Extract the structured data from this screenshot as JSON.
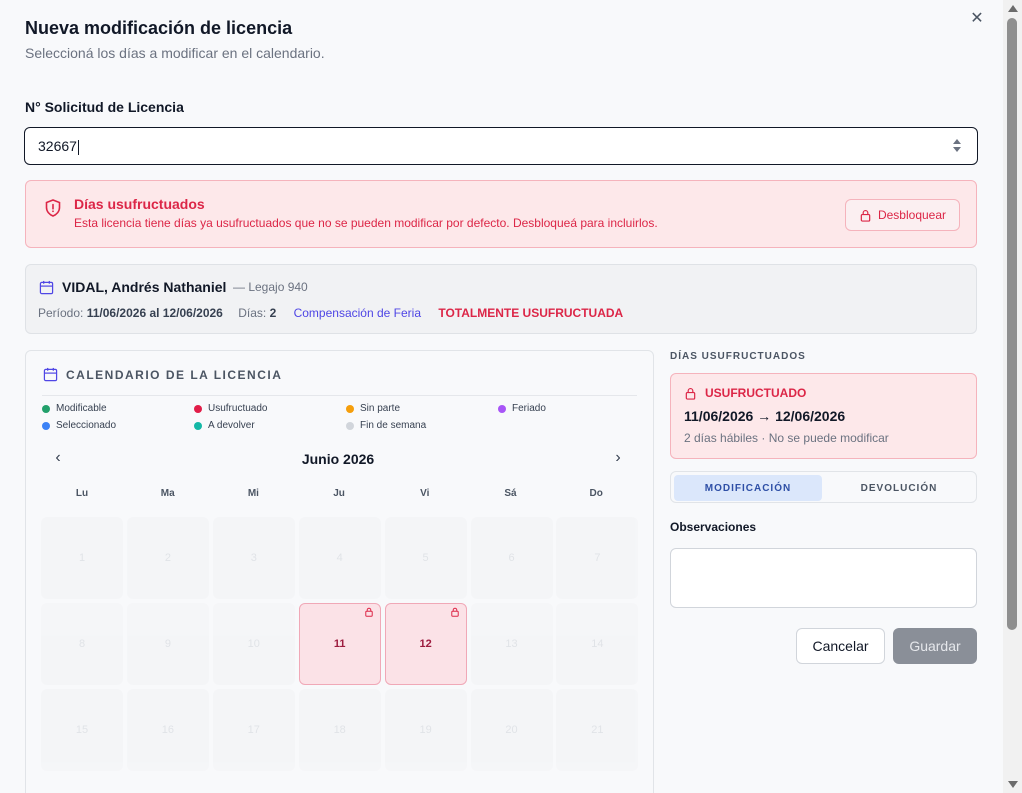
{
  "dialog": {
    "title": "Nueva modificación de licencia",
    "subtitle": "Seleccioná los días a modificar en el calendario.",
    "close_icon": "close-icon"
  },
  "request": {
    "label": "N° Solicitud de Licencia",
    "value": "32667"
  },
  "alert": {
    "title": "Días usufructuados",
    "text": "Esta licencia tiene días ya usufructuados que no se pueden modificar por defecto. Desbloqueá para incluirlos.",
    "button_label": "Desbloquear",
    "color": "#dc2647"
  },
  "employee": {
    "name": "VIDAL, Andrés Nathaniel",
    "legajo": "— Legajo 940",
    "period_label": "Período:",
    "period_value": "11/06/2026 al 12/06/2026",
    "days_label": "Días:",
    "days_value": "2",
    "type": "Compensación de Feria",
    "status": "TOTALMENTE USUFRUCTUADA"
  },
  "calendar": {
    "heading": "CALENDARIO DE LA LICENCIA",
    "legend": [
      {
        "label": "Modificable",
        "color": "#22a06b"
      },
      {
        "label": "Usufructuado",
        "color": "#e11d48"
      },
      {
        "label": "Sin parte",
        "color": "#f59e0b"
      },
      {
        "label": "Feriado",
        "color": "#a855f7"
      },
      {
        "label": "Seleccionado",
        "color": "#3b82f6"
      },
      {
        "label": "A devolver",
        "color": "#14b8a6"
      },
      {
        "label": "Fin de semana",
        "color": "#d1d5db"
      }
    ],
    "month": "Junio 2026",
    "weekdays": [
      "Lu",
      "Ma",
      "Mi",
      "Ju",
      "Vi",
      "Sá",
      "Do"
    ],
    "weeks": [
      [
        "1",
        "2",
        "3",
        "4",
        "5",
        "6",
        "7"
      ],
      [
        "8",
        "9",
        "10",
        "11",
        "12",
        "13",
        "14"
      ],
      [
        "15",
        "16",
        "17",
        "18",
        "19",
        "20",
        "21"
      ]
    ],
    "usufructuado_days": [
      "11",
      "12"
    ]
  },
  "side": {
    "section_label": "DÍAS USUFRUCTUADOS",
    "card_title": "USUFRUCTUADO",
    "card_range": "11/06/2026 → 12/06/2026",
    "card_sub": "2 días hábiles · No se puede modificar",
    "tab_modificacion": "MODIFICACIÓN",
    "tab_devolucion": "DEVOLUCIÓN",
    "obs_label": "Observaciones",
    "cancel_label": "Cancelar",
    "save_label": "Guardar"
  }
}
